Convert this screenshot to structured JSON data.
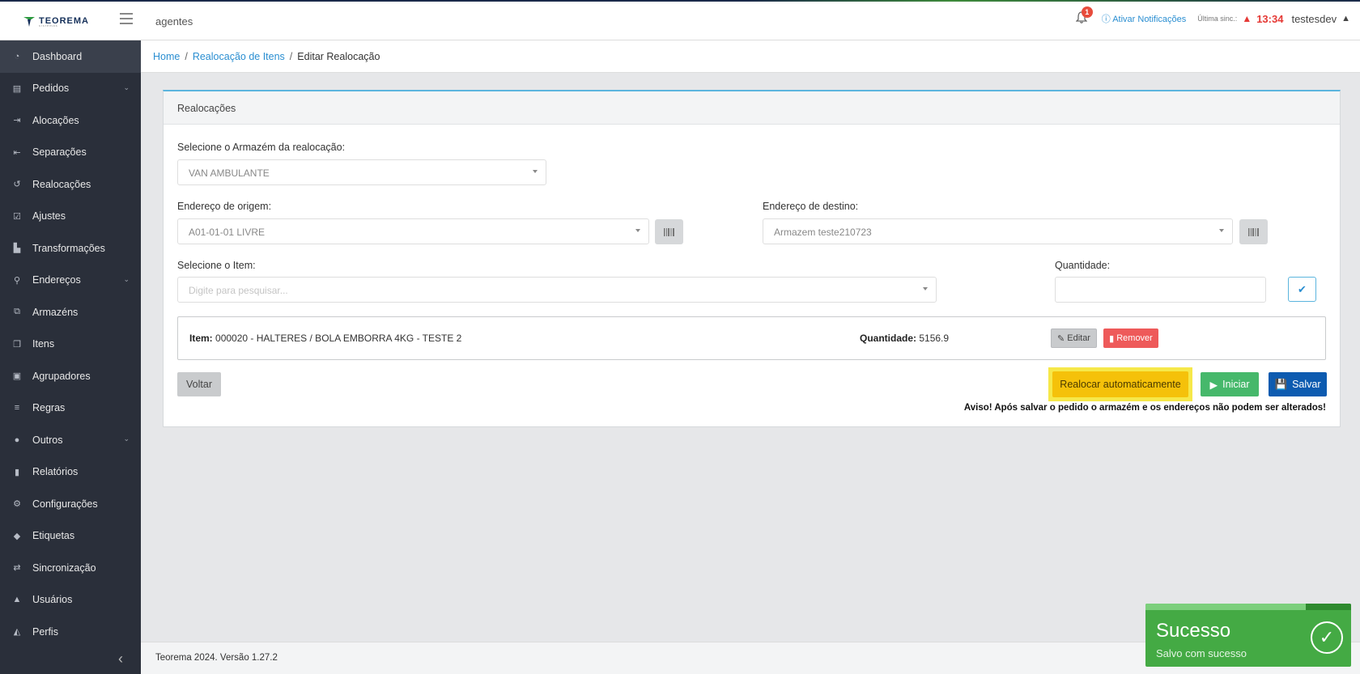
{
  "topbar": {
    "logo_text": "TEOREMA",
    "logo_sub": "sistemas",
    "app_title": "agentes",
    "notification_count": "1",
    "notif_link": "ⓘ Ativar Notificações",
    "sync_label": "Última sinc.:",
    "sync_time": "13:34",
    "username": "testesdev",
    "bell_icon": "bell-icon",
    "warning_icon": "warning-icon",
    "user_icon": "user-icon"
  },
  "sidebar": {
    "items": [
      {
        "label": "Dashboard",
        "icon": "gauge-icon",
        "glyph": "◔",
        "active": true,
        "chevron": false
      },
      {
        "label": "Pedidos",
        "icon": "list-icon",
        "glyph": "▤",
        "chevron": true
      },
      {
        "label": "Alocações",
        "icon": "sign-in-icon",
        "glyph": "⇥",
        "chevron": false
      },
      {
        "label": "Separações",
        "icon": "sign-out-icon",
        "glyph": "⇤",
        "chevron": false
      },
      {
        "label": "Realocações",
        "icon": "undo-icon",
        "glyph": "↺",
        "chevron": false
      },
      {
        "label": "Ajustes",
        "icon": "check-square-icon",
        "glyph": "☑",
        "chevron": false
      },
      {
        "label": "Transformações",
        "icon": "bar-chart-icon",
        "glyph": "▙",
        "chevron": false
      },
      {
        "label": "Endereços",
        "icon": "map-marker-icon",
        "glyph": "⚲",
        "chevron": true
      },
      {
        "label": "Armazéns",
        "icon": "cubes-icon",
        "glyph": "⧉",
        "chevron": false
      },
      {
        "label": "Itens",
        "icon": "cube-icon",
        "glyph": "❒",
        "chevron": false
      },
      {
        "label": "Agrupadores",
        "icon": "object-group-icon",
        "glyph": "▣",
        "chevron": false
      },
      {
        "label": "Regras",
        "icon": "list-ul-icon",
        "glyph": "≡",
        "chevron": false
      },
      {
        "label": "Outros",
        "icon": "info-circle-icon",
        "glyph": "●",
        "chevron": true
      },
      {
        "label": "Relatórios",
        "icon": "file-icon",
        "glyph": "▮",
        "chevron": false
      },
      {
        "label": "Configurações",
        "icon": "cog-icon",
        "glyph": "⚙",
        "chevron": false
      },
      {
        "label": "Etiquetas",
        "icon": "tags-icon",
        "glyph": "◆",
        "chevron": false
      },
      {
        "label": "Sincronização",
        "icon": "exchange-icon",
        "glyph": "⇄",
        "chevron": false
      },
      {
        "label": "Usuários",
        "icon": "user-icon",
        "glyph": "▲",
        "chevron": false
      },
      {
        "label": "Perfis",
        "icon": "users-icon",
        "glyph": "◭",
        "chevron": false
      }
    ],
    "collapse_glyph": "‹"
  },
  "breadcrumb": {
    "home": "Home",
    "parent": "Realocação de Itens",
    "current": "Editar Realocação",
    "separator": "/"
  },
  "panel": {
    "title": "Realocações",
    "warehouse_label": "Selecione o Armazém da realocação:",
    "warehouse_value": "VAN AMBULANTE",
    "origin_label": "Endereço de origem:",
    "origin_value": "A01-01-01 LIVRE",
    "dest_label": "Endereço de destino:",
    "dest_value": "Armazem teste210723",
    "item_label": "Selecione o Item:",
    "item_placeholder": "Digite para pesquisar...",
    "qty_label": "Quantidade:",
    "qty_value": "",
    "item_row": {
      "item_key": "Item:",
      "item_value": "000020 - HALTERES / BOLA EMBORRA 4KG - TESTE 2",
      "qty_key": "Quantidade:",
      "qty_value": "5156.9",
      "edit_label": "Editar",
      "remove_label": "Remover"
    },
    "buttons": {
      "back": "Voltar",
      "auto_realloc": "Realocar automaticamente",
      "start": "Iniciar",
      "save": "Salvar"
    },
    "warning": "Aviso! Após salvar o pedido o armazém e os endereços não podem ser alterados!"
  },
  "footer": {
    "text": "Teorema 2024. Versão 1.27.2"
  },
  "toast": {
    "title": "Sucesso",
    "message": "Salvo com sucesso",
    "progress": 0.78
  },
  "colors": {
    "sidebar_bg": "#2a2f3a",
    "accent_blue": "#2a8ed1",
    "success": "#44aa44",
    "danger": "#ee5a5a",
    "warning_btn": "#f5c10a",
    "save_btn": "#0d5bb0",
    "start_btn": "#46b86b"
  }
}
